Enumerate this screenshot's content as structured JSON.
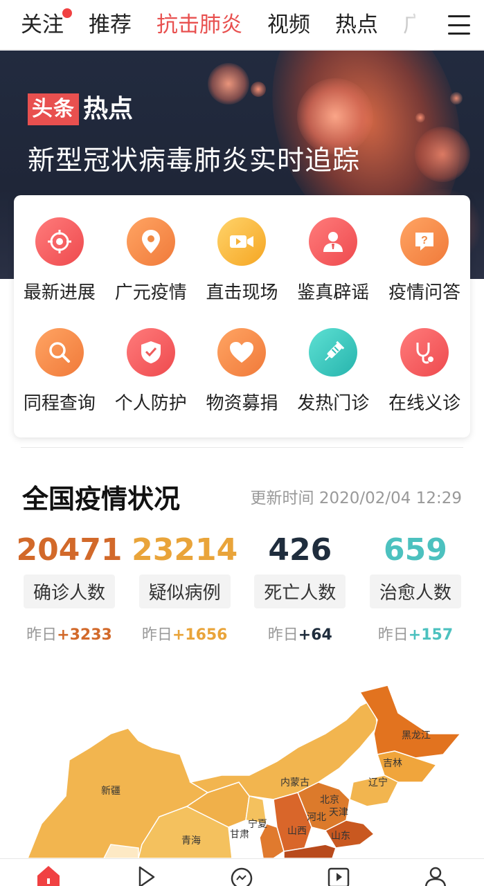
{
  "nav": {
    "tabs": [
      {
        "label": "关注",
        "has_dot": true
      },
      {
        "label": "推荐"
      },
      {
        "label": "抗击肺炎",
        "active": true
      },
      {
        "label": "视频"
      },
      {
        "label": "热点"
      },
      {
        "label": "广"
      }
    ],
    "menu_icon": "hamburger-icon"
  },
  "banner": {
    "brand_box": "头条",
    "brand_text": "热点",
    "title": "新型冠状病毒肺炎实时追踪"
  },
  "services": [
    {
      "label": "最新进展",
      "icon": "target-icon",
      "color": "red"
    },
    {
      "label": "广元疫情",
      "icon": "location-pin-icon",
      "color": "orange"
    },
    {
      "label": "直击现场",
      "icon": "video-camera-icon",
      "color": "yellow"
    },
    {
      "label": "鉴真辟谣",
      "icon": "person-icon",
      "color": "red"
    },
    {
      "label": "疫情问答",
      "icon": "question-bubble-icon",
      "color": "orange"
    },
    {
      "label": "同程查询",
      "icon": "search-icon",
      "color": "orange"
    },
    {
      "label": "个人防护",
      "icon": "shield-check-icon",
      "color": "red"
    },
    {
      "label": "物资募捐",
      "icon": "heart-icon",
      "color": "orange"
    },
    {
      "label": "发热门诊",
      "icon": "syringe-icon",
      "color": "teal"
    },
    {
      "label": "在线义诊",
      "icon": "stethoscope-icon",
      "color": "red"
    }
  ],
  "stats": {
    "title": "全国疫情状况",
    "update_time": "更新时间 2020/02/04 12:29",
    "items": [
      {
        "value": "20471",
        "label": "确诊人数",
        "delta_prefix": "昨日",
        "delta": "+3233",
        "color": "#d2692a"
      },
      {
        "value": "23214",
        "label": "疑似病例",
        "delta_prefix": "昨日",
        "delta": "+1656",
        "color": "#e9a43a"
      },
      {
        "value": "426",
        "label": "死亡人数",
        "delta_prefix": "昨日",
        "delta": "+64",
        "color": "#1f2d3d"
      },
      {
        "value": "659",
        "label": "治愈人数",
        "delta_prefix": "昨日",
        "delta": "+157",
        "color": "#4cc1bf"
      }
    ]
  },
  "map": {
    "labels": [
      "新疆",
      "内蒙古",
      "黑龙江",
      "吉林",
      "辽宁",
      "北京",
      "天津",
      "河北",
      "山西",
      "山东",
      "宁夏",
      "甘肃",
      "青海"
    ]
  },
  "bottom_bar": {
    "icons": [
      "home-icon",
      "play-icon",
      "chat-bubble-icon",
      "video-box-icon",
      "profile-icon"
    ]
  }
}
